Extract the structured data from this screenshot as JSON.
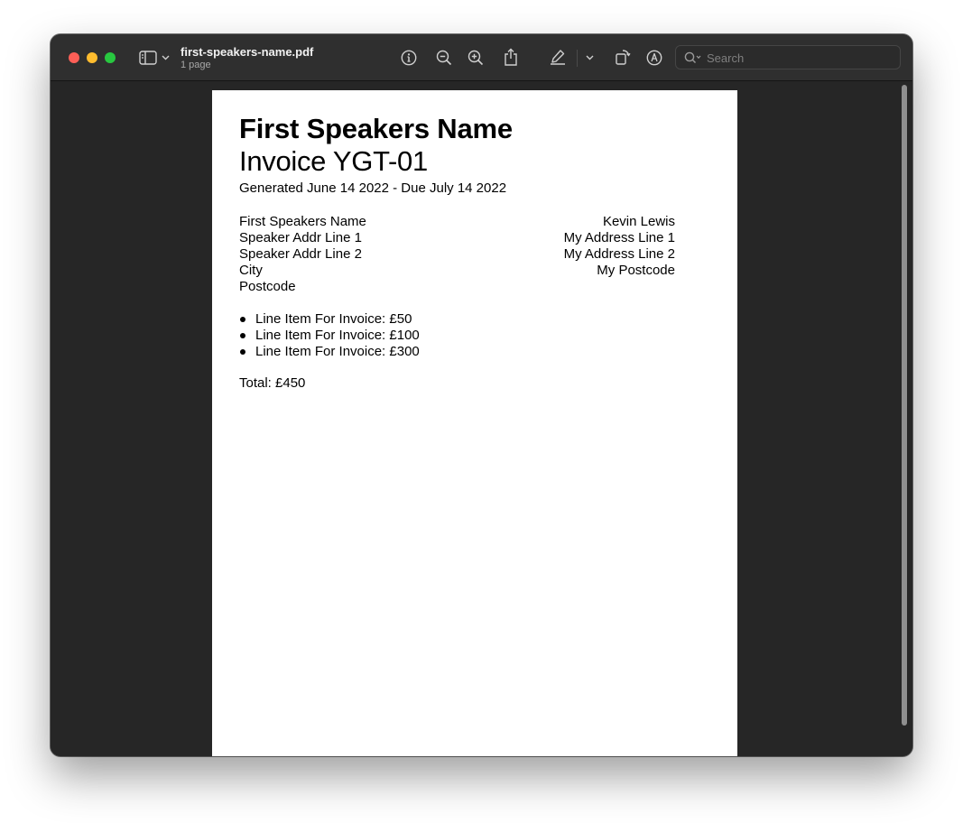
{
  "window": {
    "document_title": "first-speakers-name.pdf",
    "page_count_label": "1 page"
  },
  "toolbar": {
    "icons": [
      "sidebar-toggle-icon",
      "chevron-down-icon",
      "info-icon",
      "zoom-out-icon",
      "zoom-in-icon",
      "share-icon",
      "highlight-pen-icon",
      "chevron-down-icon",
      "rotate-icon",
      "markup-icon",
      "search-icon"
    ]
  },
  "search": {
    "placeholder": "Search",
    "value": ""
  },
  "colors": {
    "close": "#fe5f57",
    "minimize": "#febc2e",
    "maximize": "#28c840",
    "window_background": "#262626",
    "titlebar": "#2f2f2f"
  },
  "document": {
    "name": "First Speakers Name",
    "invoice": "Invoice YGT-01",
    "generated": "Generated June 14 2022 - Due July 14 2022",
    "from_address": [
      "First Speakers Name",
      "Speaker Addr Line 1",
      "Speaker Addr Line 2",
      "City",
      "Postcode"
    ],
    "to_address": [
      "Kevin Lewis",
      "My Address Line 1",
      "My Address Line 2",
      "My Postcode"
    ],
    "line_items": [
      "Line Item For Invoice: £50",
      "Line Item For Invoice: £100",
      "Line Item For Invoice: £300"
    ],
    "total": "Total: £450"
  }
}
